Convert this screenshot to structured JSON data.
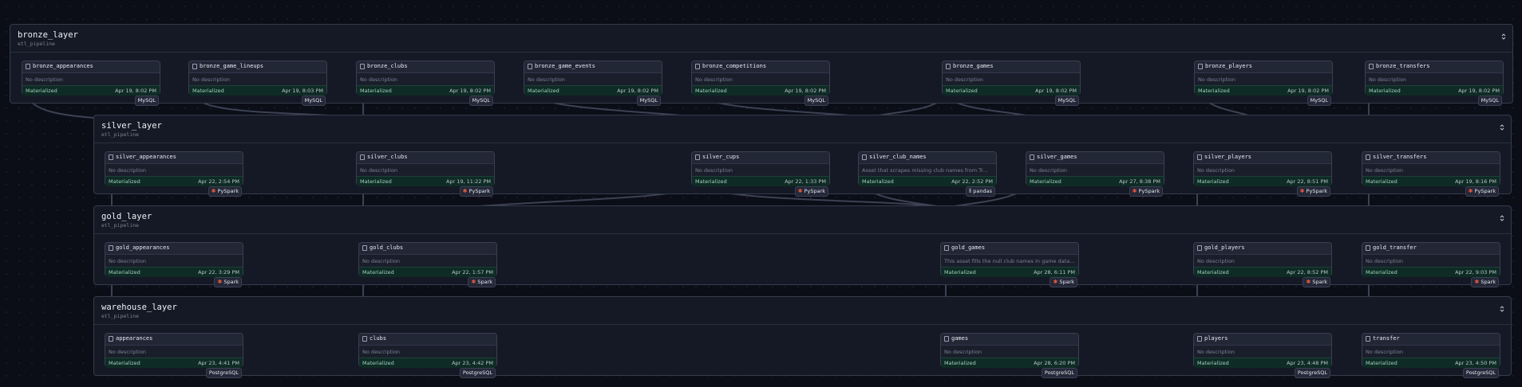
{
  "colors": {
    "canvas_bg": "#0b0d17",
    "group_bg": "#151925",
    "materialized_bg": "#0f2b25",
    "spark_icon": "#e2583e"
  },
  "icons": {
    "asset": "table-icon",
    "collapse": "chevron-up-down-icon",
    "pyspark": "spark-star-icon",
    "spark": "spark-star-icon",
    "pandas": "pandas-bars-icon"
  },
  "groups": [
    {
      "title": "bronze_layer",
      "subtitle": "etl_pipeline",
      "assets": [
        {
          "name": "bronze_appearances",
          "description": "No description",
          "status": "Materialized",
          "time": "Apr 19, 8:02 PM",
          "kind": "MySQL"
        },
        {
          "name": "bronze_game_lineups",
          "description": "No description",
          "status": "Materialized",
          "time": "Apr 19, 8:03 PM",
          "kind": "MySQL"
        },
        {
          "name": "bronze_clubs",
          "description": "No description",
          "status": "Materialized",
          "time": "Apr 19, 8:02 PM",
          "kind": "MySQL"
        },
        {
          "name": "bronze_game_events",
          "description": "No description",
          "status": "Materialized",
          "time": "Apr 19, 8:02 PM",
          "kind": "MySQL"
        },
        {
          "name": "bronze_competitions",
          "description": "No description",
          "status": "Materialized",
          "time": "Apr 19, 8:02 PM",
          "kind": "MySQL"
        },
        {
          "name": "bronze_games",
          "description": "No description",
          "status": "Materialized",
          "time": "Apr 19, 8:02 PM",
          "kind": "MySQL"
        },
        {
          "name": "bronze_players",
          "description": "No description",
          "status": "Materialized",
          "time": "Apr 19, 8:02 PM",
          "kind": "MySQL"
        },
        {
          "name": "bronze_transfers",
          "description": "No description",
          "status": "Materialized",
          "time": "Apr 19, 8:02 PM",
          "kind": "MySQL"
        }
      ]
    },
    {
      "title": "silver_layer",
      "subtitle": "etl_pipeline",
      "assets": [
        {
          "name": "silver_appearances",
          "description": "No description",
          "status": "Materialized",
          "time": "Apr 22, 2:54 PM",
          "kind": "PySpark"
        },
        {
          "name": "silver_clubs",
          "description": "No description",
          "status": "Materialized",
          "time": "Apr 19, 11:22 PM",
          "kind": "PySpark"
        },
        {
          "name": "silver_cups",
          "description": "No description",
          "status": "Materialized",
          "time": "Apr 22, 1:33 PM",
          "kind": "PySpark"
        },
        {
          "name": "silver_club_names",
          "description": "Asset that scrapes missing club names from Tr...",
          "status": "Materialized",
          "time": "Apr 22, 2:52 PM",
          "kind": "pandas"
        },
        {
          "name": "silver_games",
          "description": "No description",
          "status": "Materialized",
          "time": "Apr 27, 8:38 PM",
          "kind": "PySpark"
        },
        {
          "name": "silver_players",
          "description": "No description",
          "status": "Materialized",
          "time": "Apr 22, 8:51 PM",
          "kind": "PySpark"
        },
        {
          "name": "silver_transfers",
          "description": "No description",
          "status": "Materialized",
          "time": "Apr 19, 8:16 PM",
          "kind": "PySpark"
        }
      ]
    },
    {
      "title": "gold_layer",
      "subtitle": "etl_pipeline",
      "assets": [
        {
          "name": "gold_appearances",
          "description": "No description",
          "status": "Materialized",
          "time": "Apr 22, 3:29 PM",
          "kind": "Spark"
        },
        {
          "name": "gold_clubs",
          "description": "No description",
          "status": "Materialized",
          "time": "Apr 22, 1:57 PM",
          "kind": "Spark"
        },
        {
          "name": "gold_games",
          "description": "This asset fills the null club names in game data...",
          "status": "Materialized",
          "time": "Apr 28, 6:11 PM",
          "kind": "Spark"
        },
        {
          "name": "gold_players",
          "description": "No description",
          "status": "Materialized",
          "time": "Apr 22, 8:52 PM",
          "kind": "Spark"
        },
        {
          "name": "gold_transfer",
          "description": "No description",
          "status": "Materialized",
          "time": "Apr 22, 9:03 PM",
          "kind": "Spark"
        }
      ]
    },
    {
      "title": "warehouse_layer",
      "subtitle": "etl_pipeline",
      "assets": [
        {
          "name": "appearances",
          "description": "No description",
          "status": "Materialized",
          "time": "Apr 23, 4:41 PM",
          "kind": "PostgreSQL"
        },
        {
          "name": "clubs",
          "description": "No description",
          "status": "Materialized",
          "time": "Apr 23, 4:42 PM",
          "kind": "PostgreSQL"
        },
        {
          "name": "games",
          "description": "No description",
          "status": "Materialized",
          "time": "Apr 28, 6:20 PM",
          "kind": "PostgreSQL"
        },
        {
          "name": "players",
          "description": "No description",
          "status": "Materialized",
          "time": "Apr 23, 4:48 PM",
          "kind": "PostgreSQL"
        },
        {
          "name": "transfer",
          "description": "No description",
          "status": "Materialized",
          "time": "Apr 23, 4:50 PM",
          "kind": "PostgreSQL"
        }
      ]
    }
  ]
}
